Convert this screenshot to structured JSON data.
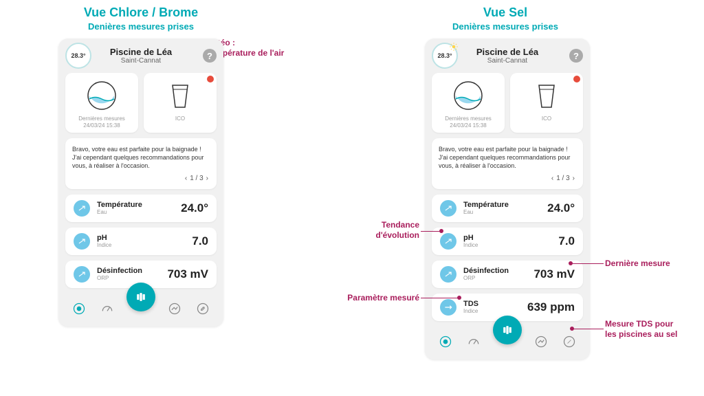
{
  "views": {
    "left": {
      "title": "Vue Chlore / Brome",
      "subtitle": "Denières mesures prises"
    },
    "right": {
      "title": "Vue Sel",
      "subtitle": "Denières mesures prises"
    }
  },
  "header": {
    "weather_temp": "28.3°",
    "pool_name": "Piscine de Léa",
    "location": "Saint-Cannat",
    "help": "?"
  },
  "tiles": {
    "measures_label": "Dernières mesures\n24/03/24 15:38",
    "ico_label": "ICO"
  },
  "message": {
    "text": "Bravo, votre eau est parfaite pour la baignade ! J'ai cependant quelques recommandations pour vous, à réaliser à l'occasion.",
    "pager": "1 / 3"
  },
  "metrics": {
    "temperature": {
      "name": "Température",
      "sub": "Eau",
      "value": "24.0°"
    },
    "ph": {
      "name": "pH",
      "sub": "Indice",
      "value": "7.0"
    },
    "disinfection": {
      "name": "Désinfection",
      "sub": "ORP",
      "value": "703 mV"
    },
    "tds": {
      "name": "TDS",
      "sub": "Indice",
      "value": "639 ppm"
    }
  },
  "annotations": {
    "weather": "Météo :\nTempérature de l'air",
    "trend": "Tendance\nd'évolution",
    "last_measure": "Dernière mesure",
    "param": "Paramètre mesuré",
    "tds": "Mesure TDS pour\nles piscines au sel"
  }
}
